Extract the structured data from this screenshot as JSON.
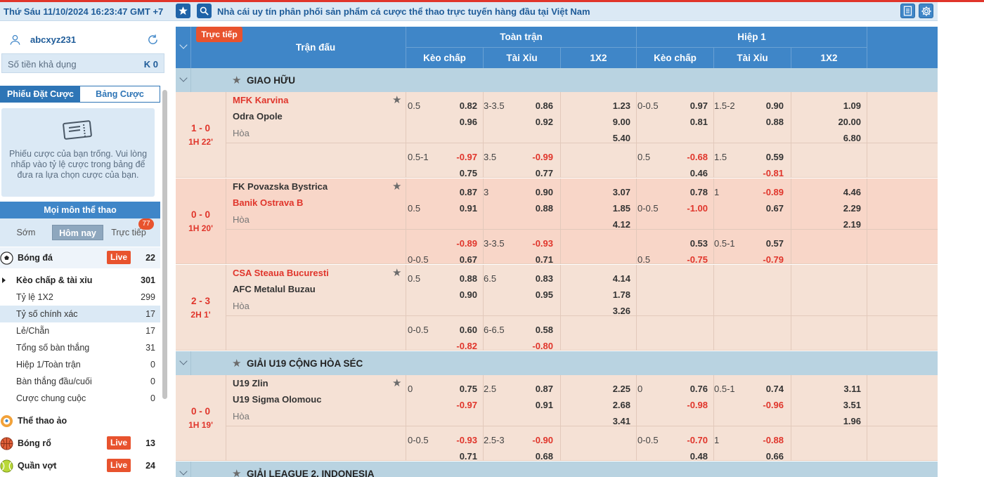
{
  "topbar": {
    "clock": "Thứ Sáu 11/10/2024 16:23:47 GMT +7",
    "marquee": "Nhà cái uy tín phân phối sản phẩm cá cược thể thao trực tuyến hàng đầu tại Việt Nam"
  },
  "sidebar": {
    "username": "abcxyz231",
    "balance_label": "Số tiền khả dụng",
    "balance_value": "K 0",
    "tab_betslip": "Phiếu Đặt Cược",
    "tab_table": "Bảng Cược",
    "empty_text": "Phiếu cược của bạn trống. Vui lòng nhấp vào tỷ lệ cược trong bảng để đưa ra lựa chọn cược của bạn.",
    "sports_header": "Mọi môn thể thao",
    "time_tabs": [
      "Sớm",
      "Hôm nay",
      "Trực tiếp"
    ],
    "live_badge_count": "77",
    "live_label": "Live",
    "football": {
      "name": "Bóng đá",
      "count": "22"
    },
    "sub_items": [
      {
        "name": "Kèo chấp & tài xỉu",
        "count": "301"
      },
      {
        "name": "Tỷ lệ 1X2",
        "count": "299"
      },
      {
        "name": "Tỷ số chính xác",
        "count": "17"
      },
      {
        "name": "Lẻ/Chẵn",
        "count": "17"
      },
      {
        "name": "Tổng số bàn thắng",
        "count": "31"
      },
      {
        "name": "Hiệp 1/Toàn trận",
        "count": "0"
      },
      {
        "name": "Bàn thắng đầu/cuối",
        "count": "0"
      },
      {
        "name": "Cược chung cuộc",
        "count": "0"
      }
    ],
    "virtual": {
      "name": "Thể thao ảo"
    },
    "basketball": {
      "name": "Bóng rổ",
      "count": "13"
    },
    "tennis": {
      "name": "Quần vợt",
      "count": "24"
    }
  },
  "table": {
    "live_badge": "Trực tiếp",
    "col_match": "Trận đấu",
    "group_full": "Toàn trận",
    "group_half": "Hiệp 1",
    "sub_cols": [
      "Kèo chấp",
      "Tài Xỉu",
      "1X2",
      "Kèo chấp",
      "Tài Xỉu",
      "1X2"
    ],
    "leagues": [
      "GIAO HỮU",
      "GIẢI U19 CỘNG HÒA SÉC",
      "GIẢI LEAGUE 2, INDONESIA"
    ],
    "draw_label": "Hòa",
    "matches": [
      {
        "score": "1 - 0",
        "time": "1H 22'",
        "home": "MFK Karvina",
        "away": "Odra Opole",
        "r1": {
          "hc": "0.5",
          "h1": "0.82",
          "ou": "3-3.5",
          "o1": "0.86",
          "x1": "1.23",
          "hhc": "0-0.5",
          "hh1": "0.97",
          "hou": "1.5-2",
          "ho1": "0.90",
          "hx1": "1.09"
        },
        "r2": {
          "h2": "0.96",
          "o2": "0.92",
          "x2": "9.00",
          "hh2": "0.81",
          "ho2": "0.88",
          "hx2": "20.00"
        },
        "r3": {
          "x3": "5.40",
          "hx3": "6.80"
        },
        "r4": {
          "hc": "0.5-1",
          "h1": "-0.97",
          "ou": "3.5",
          "o1": "-0.99",
          "hhc": "0.5",
          "hh1": "-0.68",
          "hou": "1.5",
          "ho1": "0.59"
        },
        "r5": {
          "h2": "0.75",
          "o2": "0.77",
          "hh2": "0.46",
          "ho2": "-0.81"
        }
      },
      {
        "score": "0 - 0",
        "time": "1H 20'",
        "home": "FK Povazska Bystrica",
        "away": "Banik Ostrava B",
        "r1": {
          "h1": "0.87",
          "ou": "3",
          "o1": "0.90",
          "x1": "3.07",
          "hh1": "0.78",
          "hou": "1",
          "ho1": "-0.89",
          "hx1": "4.46"
        },
        "r2": {
          "hc": "0.5",
          "h2": "0.91",
          "o2": "0.88",
          "x2": "1.85",
          "hhc": "0-0.5",
          "hh2": "-1.00",
          "ho2": "0.67",
          "hx2": "2.29"
        },
        "r3": {
          "x3": "4.12",
          "hx3": "2.19"
        },
        "r4": {
          "h1": "-0.89",
          "ou": "3-3.5",
          "o1": "-0.93",
          "hh1": "0.53",
          "hou": "0.5-1",
          "ho1": "0.57"
        },
        "r5": {
          "hc": "0-0.5",
          "h2": "0.67",
          "o2": "0.71",
          "hhc": "0.5",
          "hh2": "-0.75",
          "ho2": "-0.79"
        }
      },
      {
        "score": "2 - 3",
        "time": "2H 1'",
        "home": "CSA Steaua Bucuresti",
        "away": "AFC Metalul Buzau",
        "r1": {
          "hc": "0.5",
          "h1": "0.88",
          "ou": "6.5",
          "o1": "0.83",
          "x1": "4.14"
        },
        "r2": {
          "h2": "0.90",
          "o2": "0.95",
          "x2": "1.78"
        },
        "r3": {
          "x3": "3.26"
        },
        "r4": {
          "hc": "0-0.5",
          "h1": "0.60",
          "ou": "6-6.5",
          "o1": "0.58"
        },
        "r5": {
          "h2": "-0.82",
          "o2": "-0.80"
        }
      },
      {
        "score": "0 - 0",
        "time": "1H 19'",
        "home": "U19 Zlin",
        "away": "U19 Sigma Olomouc",
        "r1": {
          "hc": "0",
          "h1": "0.75",
          "ou": "2.5",
          "o1": "0.87",
          "x1": "2.25",
          "hhc": "0",
          "hh1": "0.76",
          "hou": "0.5-1",
          "ho1": "0.74",
          "hx1": "3.11"
        },
        "r2": {
          "h2": "-0.97",
          "o2": "0.91",
          "x2": "2.68",
          "hh2": "-0.98",
          "ho2": "-0.96",
          "hx2": "3.51"
        },
        "r3": {
          "x3": "3.41",
          "hx3": "1.96"
        },
        "r4": {
          "hc": "0-0.5",
          "h1": "-0.93",
          "ou": "2.5-3",
          "o1": "-0.90",
          "hhc": "0-0.5",
          "hh1": "-0.70",
          "hou": "1",
          "ho1": "-0.88"
        },
        "r5": {
          "h2": "0.71",
          "o2": "0.68",
          "hh2": "0.48",
          "ho2": "0.66"
        }
      }
    ]
  }
}
